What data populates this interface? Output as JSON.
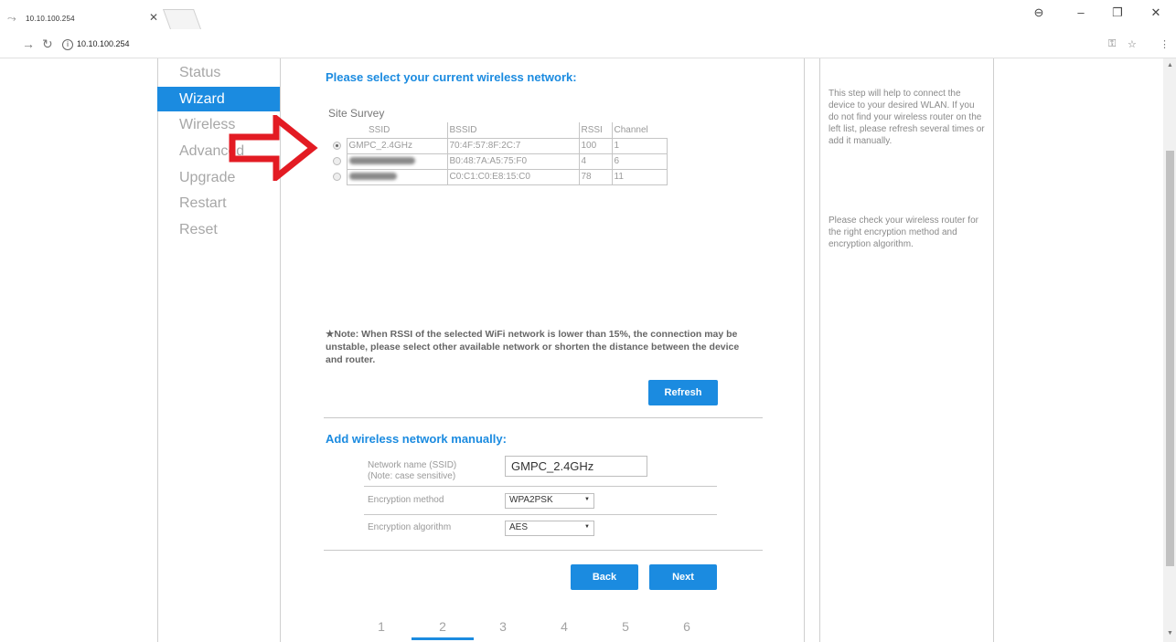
{
  "browser": {
    "tab_title": "10.10.100.254",
    "url": "10.10.100.254"
  },
  "menu": {
    "items": [
      {
        "label": "Status"
      },
      {
        "label": "Wizard"
      },
      {
        "label": "Wireless"
      },
      {
        "label": "Advanced"
      },
      {
        "label": "Upgrade"
      },
      {
        "label": "Restart"
      },
      {
        "label": "Reset"
      }
    ],
    "active": "Wizard"
  },
  "main": {
    "select_heading": "Please select your current wireless network:",
    "site_survey_label": "Site Survey",
    "table": {
      "headers": [
        "SSID",
        "BSSID",
        "RSSI",
        "Channel"
      ],
      "rows": [
        {
          "ssid": "GMPC_2.4GHz",
          "bssid": "70:4F:57:8F:2C:7",
          "rssi": "100",
          "channel": "1",
          "selected": true
        },
        {
          "ssid": "",
          "bssid": "B0:48:7A:A5:75:F0",
          "rssi": "4",
          "channel": "6",
          "selected": false
        },
        {
          "ssid": "",
          "bssid": "C0:C1:C0:E8:15:C0",
          "rssi": "78",
          "channel": "11",
          "selected": false
        }
      ]
    },
    "note": "★Note: When RSSI of the selected WiFi network is lower than 15%, the connection may be unstable, please select other available network or shorten the distance between the device and router.",
    "refresh_label": "Refresh",
    "manual_heading": "Add wireless network manually:",
    "form": {
      "ssid_label_1": "Network name (SSID)",
      "ssid_label_2": "(Note: case sensitive)",
      "ssid_value": "GMPC_2.4GHz",
      "enc_method_label": "Encryption method",
      "enc_method_value": "WPA2PSK",
      "enc_algo_label": "Encryption algorithm",
      "enc_algo_value": "AES"
    },
    "back_label": "Back",
    "next_label": "Next",
    "steps": [
      "1",
      "2",
      "3",
      "4",
      "5",
      "6"
    ],
    "current_step": "2"
  },
  "help": {
    "paragraph_1": "This step will help to connect the device to your desired WLAN. If you do not find your wireless router on the left list, please refresh several times or add it manually.",
    "paragraph_2": "Please check your wireless router for the right encryption method and encryption algorithm."
  },
  "colors": {
    "accent": "#1b8be0",
    "arrow": "#e31b23"
  }
}
